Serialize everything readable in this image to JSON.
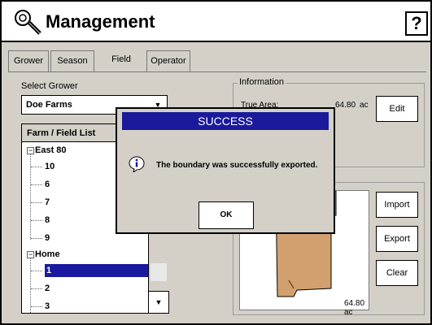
{
  "app": {
    "title": "Management",
    "help_label": "?"
  },
  "tabs": [
    {
      "label": "Grower"
    },
    {
      "label": "Season"
    },
    {
      "label": "Field"
    },
    {
      "label": "Operator"
    }
  ],
  "select_grower": {
    "label": "Select Grower",
    "value": "Doe Farms"
  },
  "list": {
    "header": "Farm / Field List",
    "items": [
      {
        "label": "East 80"
      },
      {
        "label": "10"
      },
      {
        "label": "6"
      },
      {
        "label": "7"
      },
      {
        "label": "8"
      },
      {
        "label": "9"
      },
      {
        "label": "Home"
      },
      {
        "label": "1"
      },
      {
        "label": "2"
      },
      {
        "label": "3"
      }
    ]
  },
  "information": {
    "title": "Information",
    "true_area_label": "True Area:",
    "true_area_value": "64.80",
    "true_area_unit": "ac",
    "edit_label": "Edit"
  },
  "boundary": {
    "area_label": "64.80 ac",
    "import_label": "Import",
    "export_label": "Export",
    "clear_label": "Clear",
    "field_color": "#d2a06e"
  },
  "dialog": {
    "title": "SUCCESS",
    "message": "The boundary was successfully exported.",
    "ok_label": "OK"
  }
}
